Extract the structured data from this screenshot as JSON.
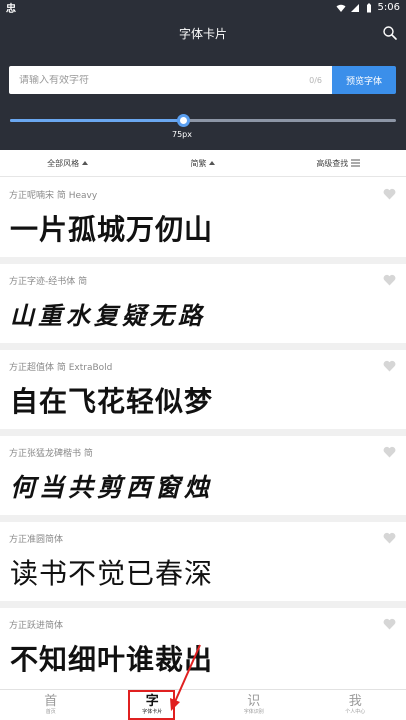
{
  "status_bar": {
    "left_icon_text": "忠",
    "time": "5:06"
  },
  "header": {
    "title": "字体卡片"
  },
  "search": {
    "placeholder": "请输入有效字符",
    "counter": "0/6",
    "preview_button": "预览字体"
  },
  "size_slider": {
    "label": "75px",
    "fraction": 0.448
  },
  "filters": [
    {
      "label": "全部风格"
    },
    {
      "label": "简繁"
    },
    {
      "label": "高级查找"
    }
  ],
  "fonts": [
    {
      "name": "方正呢喃宋 简 Heavy",
      "sample": "一片孤城万仞山",
      "favorited": false
    },
    {
      "name": "方正字迹-经书体 简",
      "sample": "山重水复疑无路",
      "favorited": false
    },
    {
      "name": "方正超值体 简 ExtraBold",
      "sample": "自在飞花轻似梦",
      "favorited": false
    },
    {
      "name": "方正张猛龙碑楷书 简",
      "sample": "何当共剪西窗烛",
      "favorited": false
    },
    {
      "name": "方正准圆简体",
      "sample": "读书不觉已春深",
      "favorited": false
    },
    {
      "name": "方正跃进简体",
      "sample": "不知细叶谁裁出",
      "favorited": false
    }
  ],
  "bottom_nav": [
    {
      "glyph": "首",
      "label": "首页",
      "active": false
    },
    {
      "glyph": "字",
      "label": "字体卡片",
      "active": true
    },
    {
      "glyph": "识",
      "label": "字体识别",
      "active": false
    },
    {
      "glyph": "我",
      "label": "个人中心",
      "active": false
    }
  ],
  "colors": {
    "header_bg": "#2b2f38",
    "accent": "#3b8fea",
    "highlight": "#e02020"
  }
}
